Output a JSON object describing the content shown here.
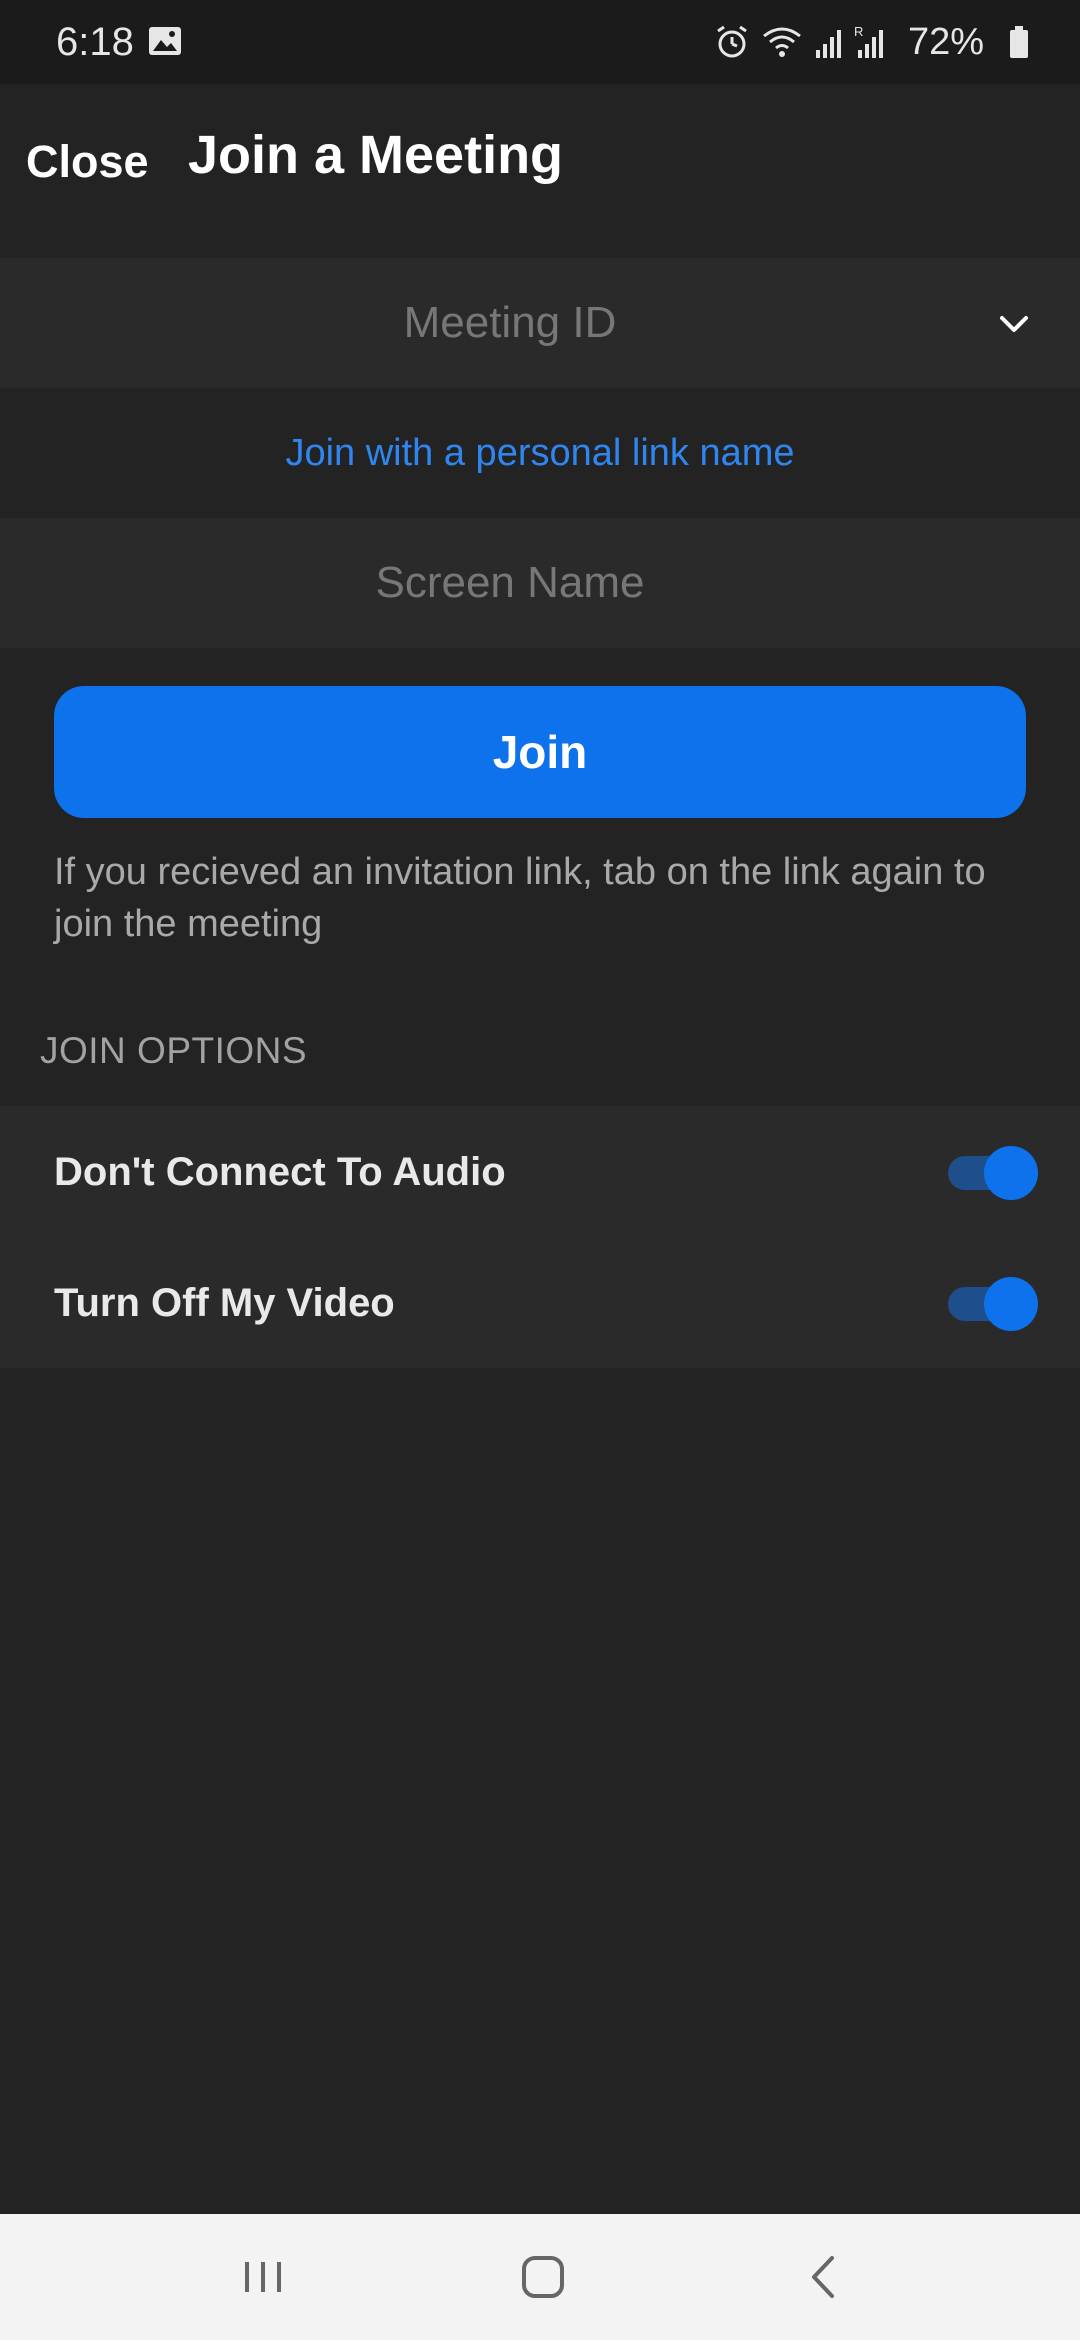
{
  "status_bar": {
    "time": "6:18",
    "battery_percent": "72%",
    "icons": [
      "gallery-icon",
      "alarm-icon",
      "wifi-icon",
      "signal-icon",
      "signal-roaming-icon",
      "battery-icon"
    ]
  },
  "header": {
    "close_label": "Close",
    "title": "Join a Meeting"
  },
  "meeting_id": {
    "value": "",
    "placeholder": "Meeting ID",
    "dropdown_icon": "chevron-down-icon"
  },
  "personal_link_label": "Join with a personal link name",
  "screen_name": {
    "value": "",
    "placeholder": "Screen Name"
  },
  "join_button_label": "Join",
  "help_text": "If you recieved an invitation link, tab on the link again to join the meeting",
  "join_options": {
    "section_label": "JOIN OPTIONS",
    "items": [
      {
        "label": "Don't Connect To Audio",
        "enabled": true
      },
      {
        "label": "Turn Off My Video",
        "enabled": true
      }
    ]
  },
  "colors": {
    "accent": "#0e72ec",
    "link": "#2f86f0",
    "background": "#232323",
    "field_background": "#2a2a2a"
  },
  "nav_bar": {
    "icons": [
      "recent-apps-icon",
      "home-icon",
      "back-icon"
    ]
  }
}
